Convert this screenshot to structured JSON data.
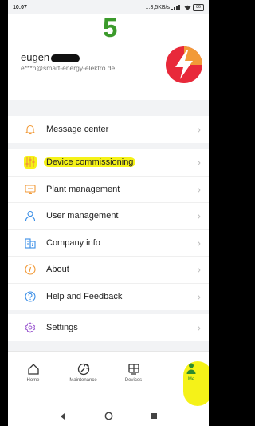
{
  "status_bar": {
    "time": "10:07",
    "net_speed": "...3,5KB/s",
    "battery": "86"
  },
  "annotation_step": "5",
  "profile": {
    "username": "eugen",
    "email": "e***n@smart-energy-elektro.de"
  },
  "menu_group_1": [
    {
      "label": "Message center",
      "icon": "bell-icon"
    }
  ],
  "menu_group_2": [
    {
      "label": "Device commissioning",
      "icon": "sliders-icon"
    },
    {
      "label": "Plant management",
      "icon": "monitor-icon"
    },
    {
      "label": "User management",
      "icon": "user-icon"
    },
    {
      "label": "Company info",
      "icon": "building-icon"
    },
    {
      "label": "About",
      "icon": "info-icon"
    },
    {
      "label": "Help and Feedback",
      "icon": "help-icon"
    }
  ],
  "menu_group_3": [
    {
      "label": "Settings",
      "icon": "gear-icon"
    }
  ],
  "tabs": [
    {
      "label": "Home",
      "icon": "home-icon"
    },
    {
      "label": "Maintenance",
      "icon": "maintenance-icon"
    },
    {
      "label": "Devices",
      "icon": "devices-icon"
    },
    {
      "label": "Me",
      "icon": "person-icon",
      "active": true
    }
  ],
  "colors": {
    "accent": "#f29a38",
    "active_tab": "#2e8b2e",
    "highlight": "#f5f218",
    "step_number": "#3b9a2b"
  }
}
